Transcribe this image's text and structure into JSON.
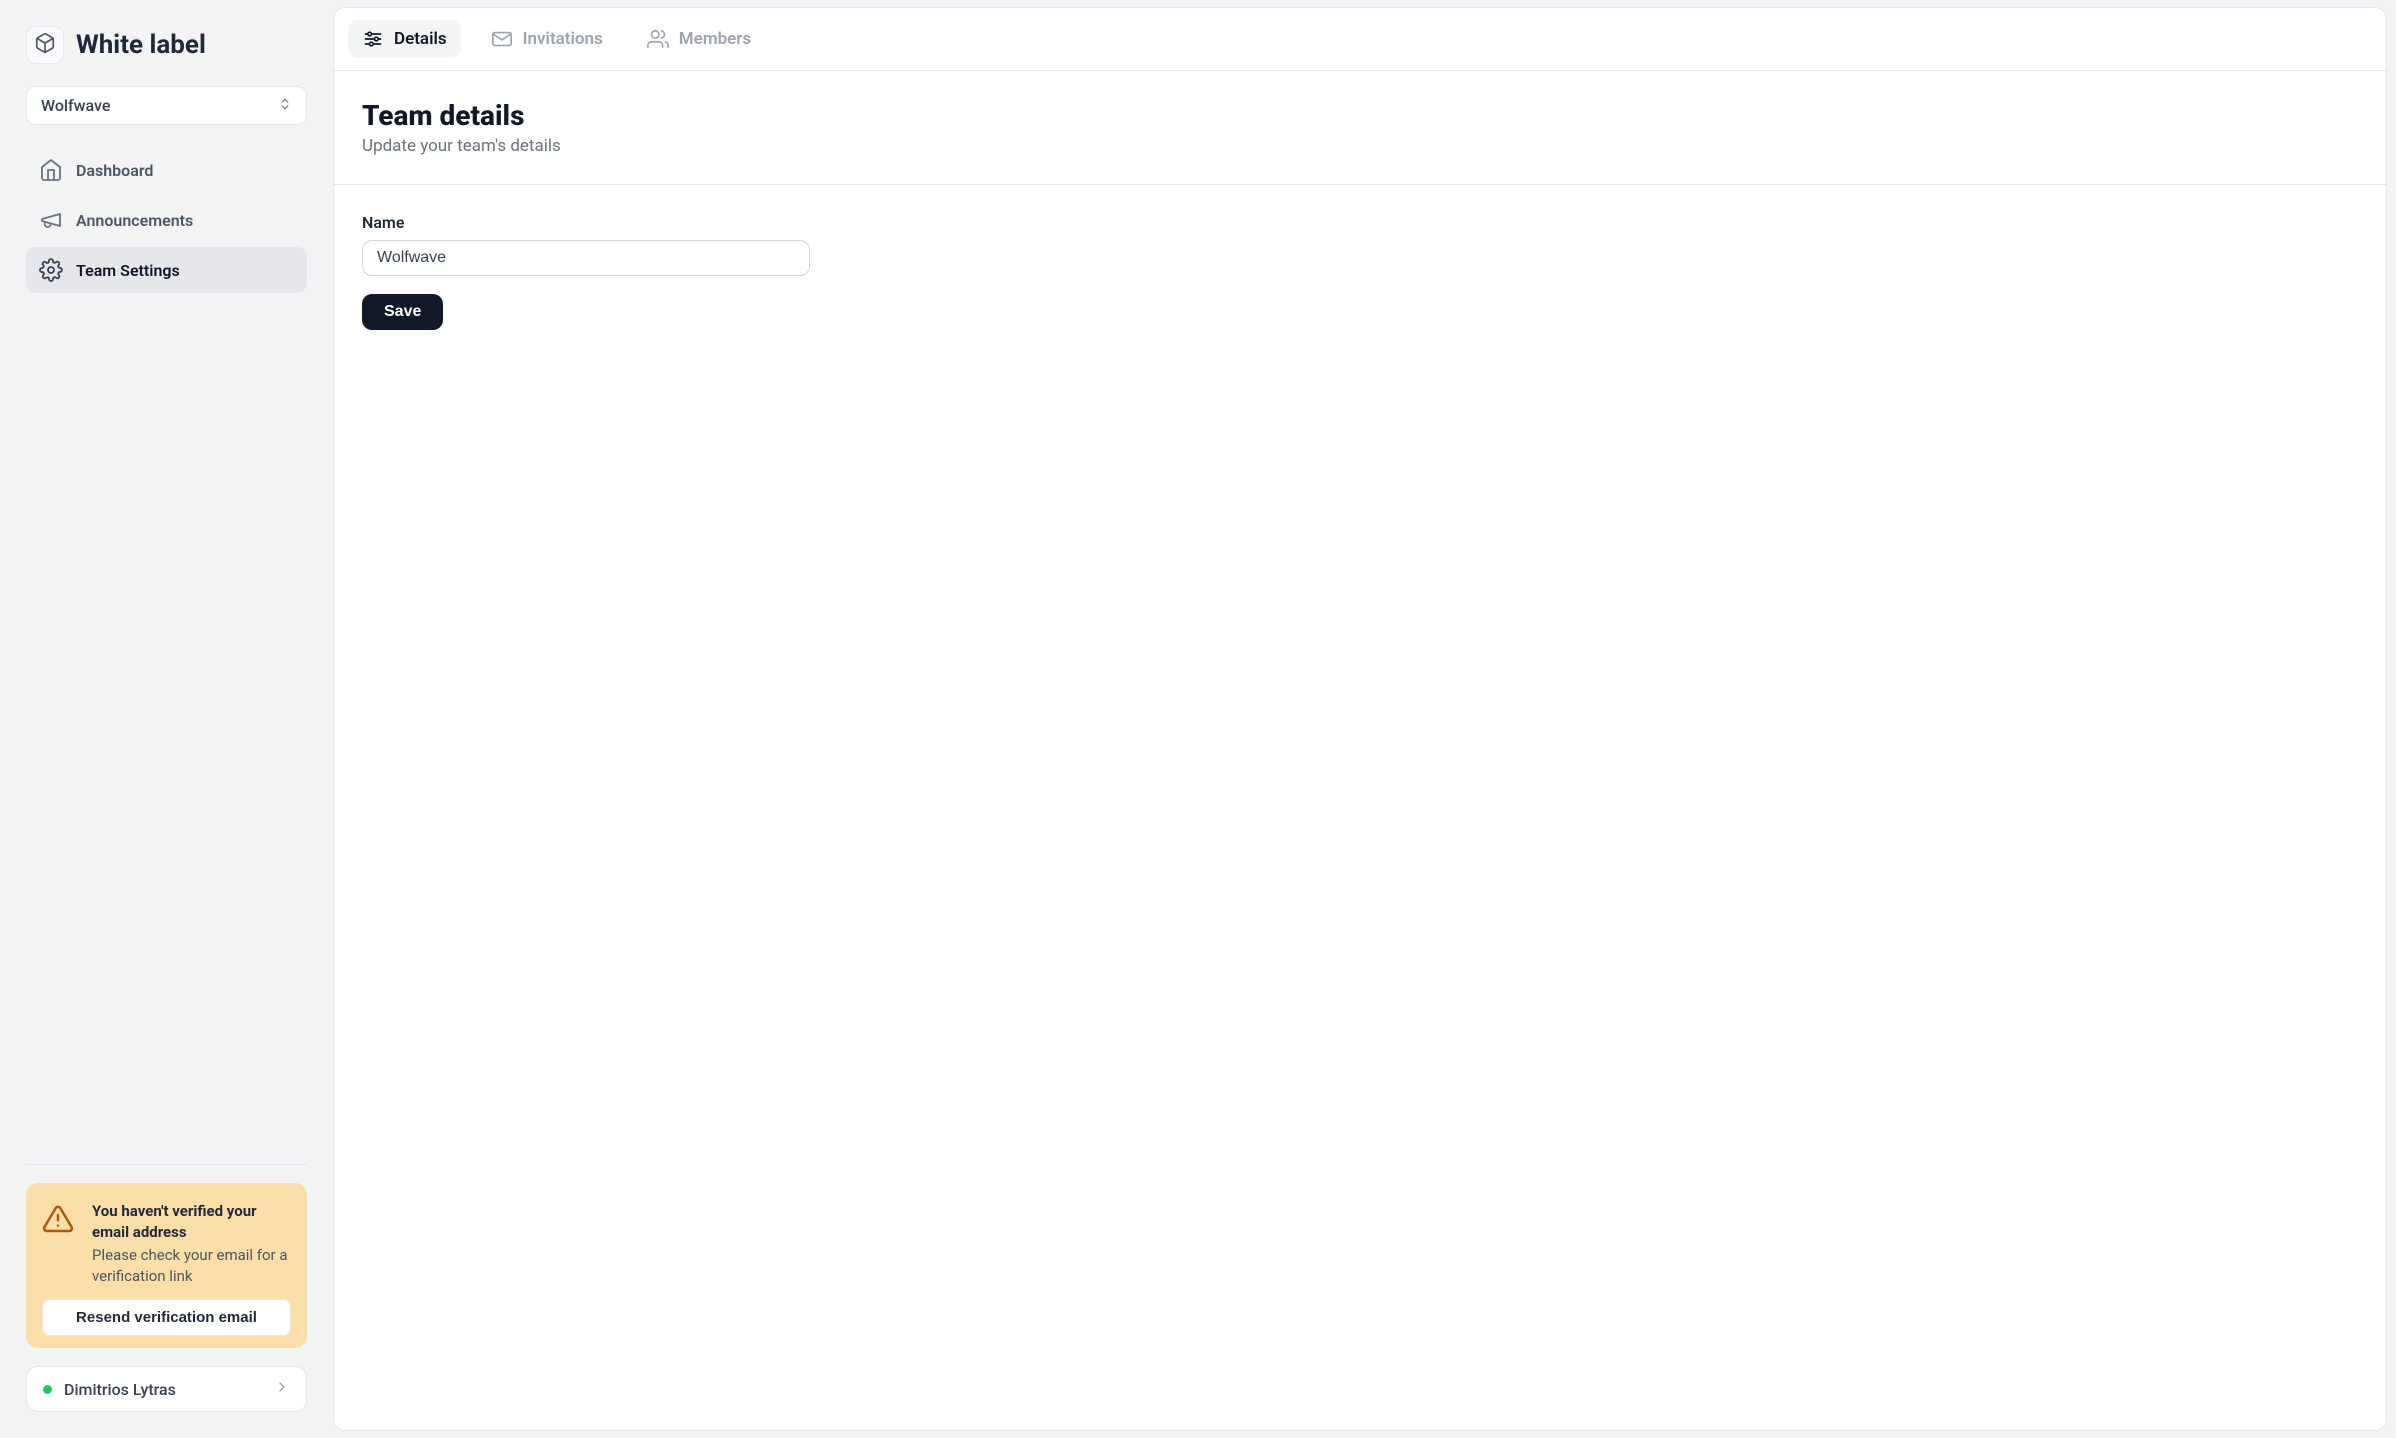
{
  "brand": {
    "title": "White label"
  },
  "team_selector": {
    "selected": "Wolfwave"
  },
  "sidebar": {
    "items": [
      {
        "label": "Dashboard"
      },
      {
        "label": "Announcements"
      },
      {
        "label": "Team Settings"
      }
    ]
  },
  "alert": {
    "heading": "You haven't verified your email address",
    "text": "Please check your email for a verification link",
    "button_label": "Resend verification email"
  },
  "user": {
    "name": "Dimitrios Lytras"
  },
  "tabs": {
    "details": "Details",
    "invitations": "Invitations",
    "members": "Members"
  },
  "page": {
    "title": "Team details",
    "subtitle": "Update your team's details"
  },
  "form": {
    "name_label": "Name",
    "name_value": "Wolfwave",
    "save_label": "Save"
  }
}
